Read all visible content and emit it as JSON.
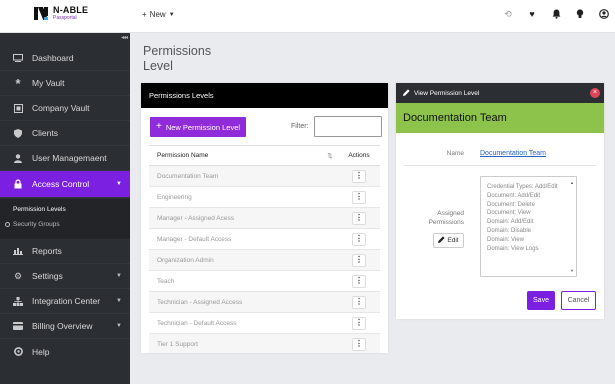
{
  "brand": {
    "name": "N-ABLE",
    "product": "Passportal"
  },
  "topbar": {
    "new_label": "New",
    "icons": [
      "history-icon",
      "heart-icon",
      "bell-icon",
      "lightbulb-icon",
      "user-icon"
    ]
  },
  "sidebar": {
    "items": [
      {
        "label": "Dashboard",
        "icon": "monitor-icon"
      },
      {
        "label": "My Vault",
        "icon": "asterisk-icon"
      },
      {
        "label": "Company Vault",
        "icon": "vault-icon"
      },
      {
        "label": "Clients",
        "icon": "shield-icon"
      },
      {
        "label": "User Managemaent",
        "icon": "user-icon"
      },
      {
        "label": "Access Control",
        "icon": "lock-icon",
        "active": true
      },
      {
        "label": "Reports",
        "icon": "chart-icon"
      },
      {
        "label": "Settings",
        "icon": "gears-icon"
      },
      {
        "label": "Integration Center",
        "icon": "sitemap-icon"
      },
      {
        "label": "Billing Overview",
        "icon": "card-icon"
      },
      {
        "label": "Help",
        "icon": "life-ring-icon"
      }
    ],
    "sub_items": [
      "Permission Levels",
      "Security Groups"
    ]
  },
  "page": {
    "title": "Permissions Level"
  },
  "levels_card": {
    "title": "Permissions Levels",
    "new_button": "New Permission Level",
    "filter_label": "Filter:",
    "filter_value": "",
    "columns": [
      "Permission Name",
      "Actions"
    ],
    "rows": [
      "Documentation Team",
      "Engineering",
      "Manager - Assigned Acess",
      "Manager - Default Access",
      "Organization Admin",
      "Teach",
      "Technician - Assigned Access",
      "Technician - Default Access",
      "Tier 1 Support"
    ]
  },
  "view_panel": {
    "header": "View Permission Level",
    "title": "Documentation Team",
    "name_label": "Name",
    "name_value": "Documentation Team",
    "assigned_label_1": "Assigned",
    "assigned_label_2": "Permissions",
    "edit_label": "Edit",
    "permissions": [
      "Credential Types: Add/Edit",
      "Document: Add/Edit",
      "Document: Delete",
      "Document: View",
      "Domain: Add/Edit",
      "Domain: Disable",
      "Domain: View",
      "Domain: View Logs"
    ],
    "save_label": "Save",
    "cancel_label": "Cancel"
  },
  "colors": {
    "accent": "#7b1fe0",
    "panel_green": "#8dc34a",
    "sidebar": "#2b2e33"
  }
}
